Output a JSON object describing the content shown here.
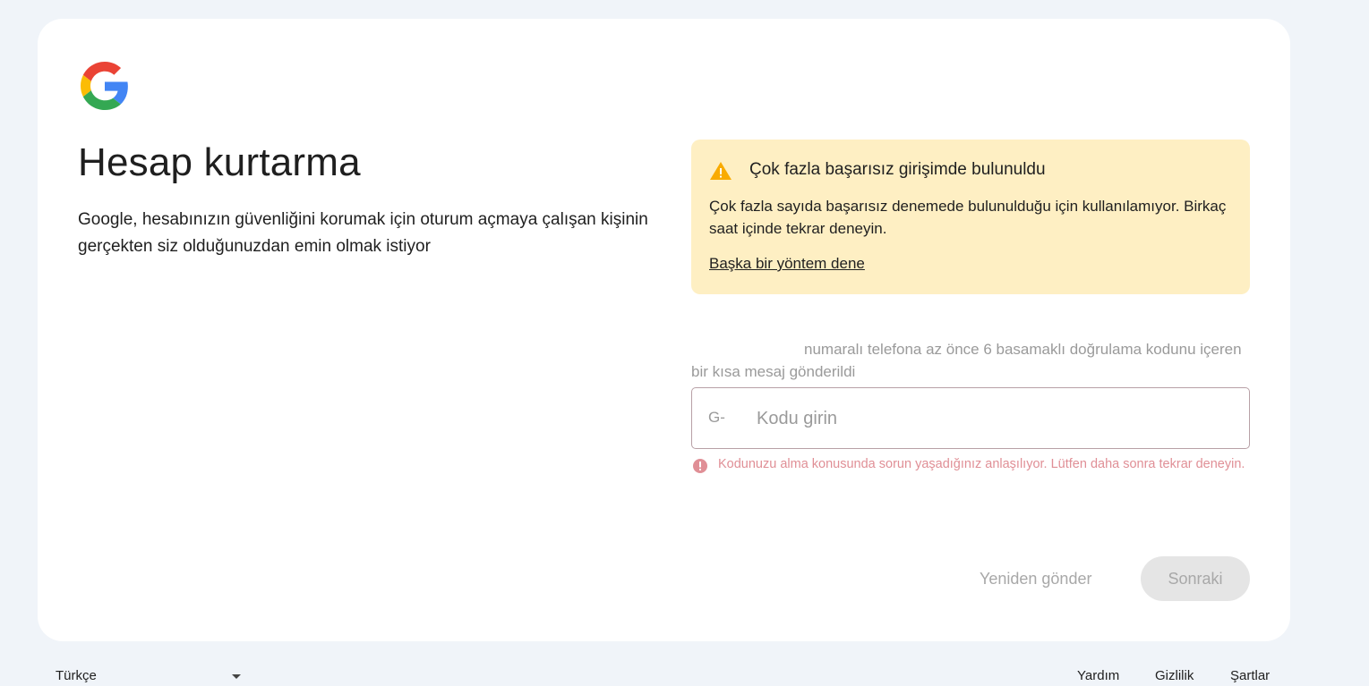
{
  "colors": {
    "background": "#f0f4f9",
    "card": "#ffffff",
    "alert_background": "#feefc3",
    "warning_icon": "#f9ab00",
    "error": "#e08f96",
    "disabled_text": "#a8a8a8"
  },
  "header": {
    "logo_icon": "google-g-logo"
  },
  "main": {
    "title": "Hesap kurtarma",
    "description": "Google, hesabınızın güvenliğini korumak için oturum açmaya çalışan kişinin gerçekten siz olduğunuzdan emin olmak istiyor"
  },
  "alert": {
    "icon": "warning-icon",
    "title": "Çok fazla başarısız girişimde bulunuldu",
    "body": "Çok fazla sayıda başarısız denemede bulunulduğu için kullanılamıyor. Birkaç saat içinde tekrar deneyin.",
    "link": "Başka bir yöntem dene"
  },
  "sms": {
    "text": "numaralı telefona az önce 6 basamaklı doğrulama kodunu içeren bir kısa mesaj gönderildi"
  },
  "code_field": {
    "prefix": "G-",
    "placeholder": "Kodu girin",
    "value": ""
  },
  "error": {
    "icon": "error-icon",
    "text": "Kodunuzu alma konusunda sorun yaşadığınız anlaşılıyor. Lütfen daha sonra tekrar deneyin."
  },
  "actions": {
    "resend_label": "Yeniden gönder",
    "next_label": "Sonraki"
  },
  "footer": {
    "language": "Türkçe",
    "links": {
      "help": "Yardım",
      "privacy": "Gizlilik",
      "terms": "Şartlar"
    }
  }
}
